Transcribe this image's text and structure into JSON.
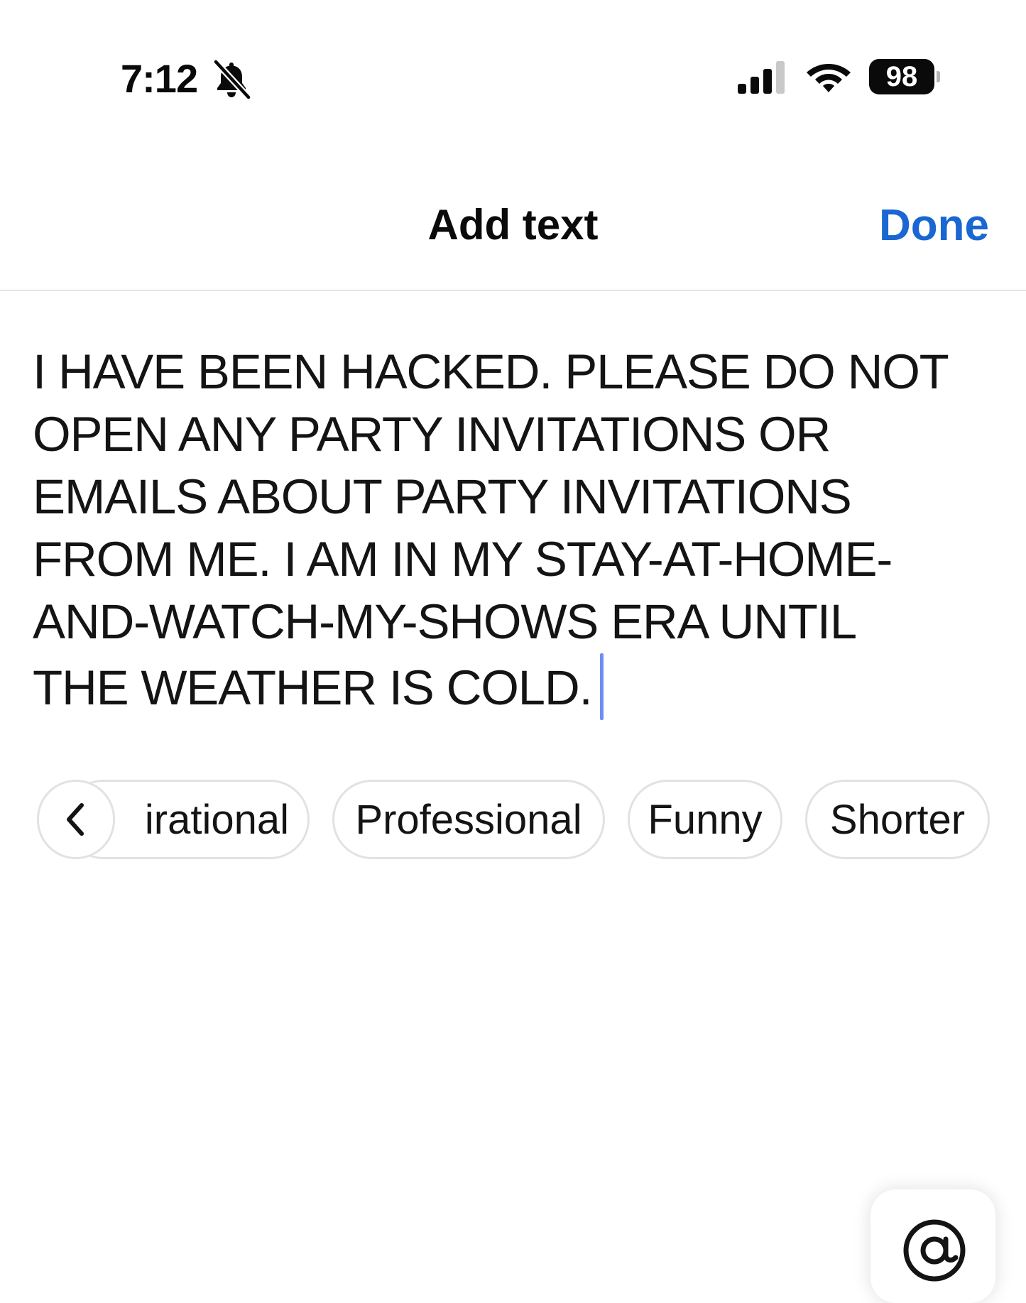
{
  "status_bar": {
    "time": "7:12",
    "battery_percent": "98",
    "icons": [
      "bell-slash-icon",
      "cellular-signal-icon",
      "wifi-icon",
      "battery-icon"
    ]
  },
  "header": {
    "title": "Add text",
    "done_label": "Done"
  },
  "editor": {
    "lines": [
      "I HAVE BEEN HACKED. PLEASE DO NOT",
      "OPEN ANY PARTY INVITATIONS OR",
      "EMAILS ABOUT PARTY INVITATIONS",
      "FROM ME. I AM IN MY STAY-AT-HOME-",
      "AND-WATCH-MY-SHOWS ERA UNTIL",
      "THE WEATHER IS COLD."
    ]
  },
  "suggestions": {
    "back_icon": "chevron-left-icon",
    "chips": [
      {
        "label": "irational"
      },
      {
        "label": "Professional"
      },
      {
        "label": "Funny"
      },
      {
        "label": "Shorter"
      }
    ]
  },
  "bottom": {
    "mention_icon": "at-sign-icon"
  },
  "colors": {
    "accent": "#1a66d2",
    "caret": "#6f8ff0",
    "text": "#141414",
    "chip_border": "#e2e2e2"
  }
}
